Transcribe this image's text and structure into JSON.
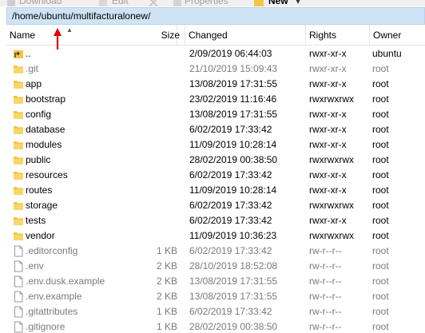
{
  "toolbar": {
    "items": [
      {
        "label": "Download",
        "state": "disabled"
      },
      {
        "label": "Edit",
        "state": "disabled"
      },
      {
        "label": "Properties",
        "state": "disabled"
      },
      {
        "label": "New",
        "state": "active"
      }
    ]
  },
  "path": "/home/ubuntu/multifacturalonew/",
  "columns": {
    "name": "Name",
    "size": "Size",
    "changed": "Changed",
    "rights": "Rights",
    "owner": "Owner"
  },
  "rows": [
    {
      "type": "parent",
      "name": "..",
      "size": "",
      "changed": "2/09/2019 06:44:03",
      "rights": "rwxr-xr-x",
      "owner": "ubuntu",
      "dim": false
    },
    {
      "type": "folder",
      "name": ".git",
      "size": "",
      "changed": "21/10/2019 15:09:43",
      "rights": "rwxr-xr-x",
      "owner": "root",
      "dim": true
    },
    {
      "type": "folder",
      "name": "app",
      "size": "",
      "changed": "13/08/2019 17:31:55",
      "rights": "rwxr-xr-x",
      "owner": "root",
      "dim": false
    },
    {
      "type": "folder",
      "name": "bootstrap",
      "size": "",
      "changed": "23/02/2019 11:16:46",
      "rights": "rwxrwxrwx",
      "owner": "root",
      "dim": false
    },
    {
      "type": "folder",
      "name": "config",
      "size": "",
      "changed": "13/08/2019 17:31:55",
      "rights": "rwxr-xr-x",
      "owner": "root",
      "dim": false
    },
    {
      "type": "folder",
      "name": "database",
      "size": "",
      "changed": "6/02/2019 17:33:42",
      "rights": "rwxr-xr-x",
      "owner": "root",
      "dim": false
    },
    {
      "type": "folder",
      "name": "modules",
      "size": "",
      "changed": "11/09/2019 10:28:14",
      "rights": "rwxr-xr-x",
      "owner": "root",
      "dim": false
    },
    {
      "type": "folder",
      "name": "public",
      "size": "",
      "changed": "28/02/2019 00:38:50",
      "rights": "rwxrwxrwx",
      "owner": "root",
      "dim": false
    },
    {
      "type": "folder",
      "name": "resources",
      "size": "",
      "changed": "6/02/2019 17:33:42",
      "rights": "rwxr-xr-x",
      "owner": "root",
      "dim": false
    },
    {
      "type": "folder",
      "name": "routes",
      "size": "",
      "changed": "11/09/2019 10:28:14",
      "rights": "rwxr-xr-x",
      "owner": "root",
      "dim": false
    },
    {
      "type": "folder",
      "name": "storage",
      "size": "",
      "changed": "6/02/2019 17:33:42",
      "rights": "rwxrwxrwx",
      "owner": "root",
      "dim": false
    },
    {
      "type": "folder",
      "name": "tests",
      "size": "",
      "changed": "6/02/2019 17:33:42",
      "rights": "rwxr-xr-x",
      "owner": "root",
      "dim": false
    },
    {
      "type": "folder",
      "name": "vendor",
      "size": "",
      "changed": "11/09/2019 10:36:23",
      "rights": "rwxrwxrwx",
      "owner": "root",
      "dim": false
    },
    {
      "type": "file",
      "name": ".editorconfig",
      "size": "1 KB",
      "changed": "6/02/2019 17:33:42",
      "rights": "rw-r--r--",
      "owner": "root",
      "dim": true
    },
    {
      "type": "file",
      "name": ".env",
      "size": "2 KB",
      "changed": "28/10/2019 18:52:08",
      "rights": "rw-r--r--",
      "owner": "root",
      "dim": true
    },
    {
      "type": "file",
      "name": ".env.dusk.example",
      "size": "2 KB",
      "changed": "13/08/2019 17:31:55",
      "rights": "rw-r--r--",
      "owner": "root",
      "dim": true
    },
    {
      "type": "file",
      "name": ".env.example",
      "size": "2 KB",
      "changed": "13/08/2019 17:31:55",
      "rights": "rw-r--r--",
      "owner": "root",
      "dim": true
    },
    {
      "type": "file",
      "name": ".gitattributes",
      "size": "1 KB",
      "changed": "6/02/2019 17:33:42",
      "rights": "rw-r--r--",
      "owner": "root",
      "dim": true
    },
    {
      "type": "file",
      "name": ".gitignore",
      "size": "1 KB",
      "changed": "28/02/2019 00:38:50",
      "rights": "rw-r--r--",
      "owner": "root",
      "dim": true
    }
  ],
  "colors": {
    "folder": "#f6c343",
    "pathbar": "#cfe3f5",
    "arrow": "#e00000"
  }
}
